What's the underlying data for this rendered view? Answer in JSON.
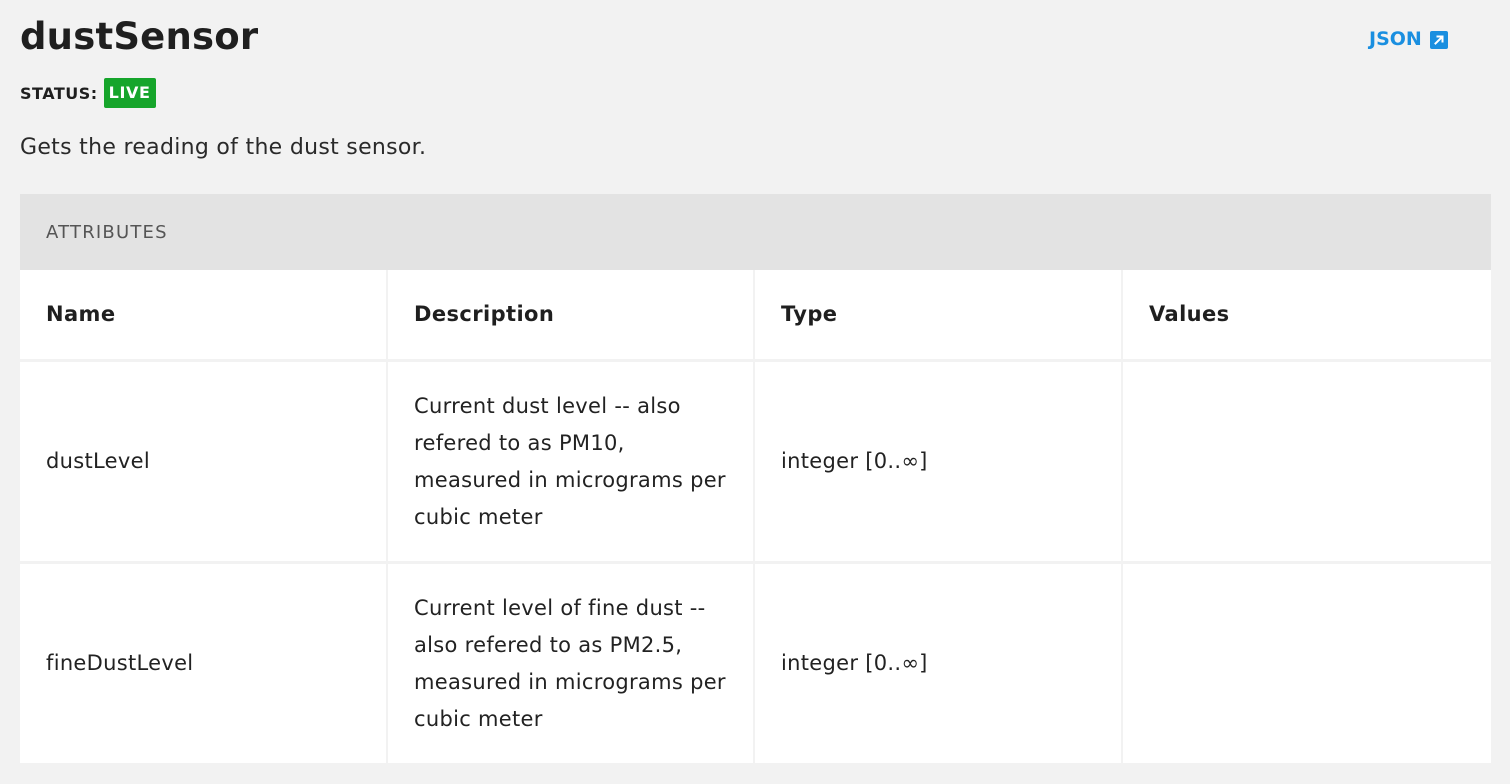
{
  "header": {
    "title": "dustSensor",
    "json_link": "JSON",
    "json_link_icon": "external-link-icon",
    "link_color": "#1a8fe0"
  },
  "status": {
    "label": "STATUS:",
    "value": "LIVE",
    "color": "#16a52b"
  },
  "description": "Gets the reading of the dust sensor.",
  "attributes": {
    "section_title": "ATTRIBUTES",
    "columns": [
      "Name",
      "Description",
      "Type",
      "Values"
    ],
    "rows": [
      {
        "name": "dustLevel",
        "description": "Current dust level -- also refered to as PM10, measured in micrograms per cubic meter",
        "type": "integer [0..∞]",
        "values": ""
      },
      {
        "name": "fineDustLevel",
        "description": "Current level of fine dust -- also refered to as PM2.5, measured in micrograms per cubic meter",
        "type": "integer [0..∞]",
        "values": ""
      }
    ]
  }
}
